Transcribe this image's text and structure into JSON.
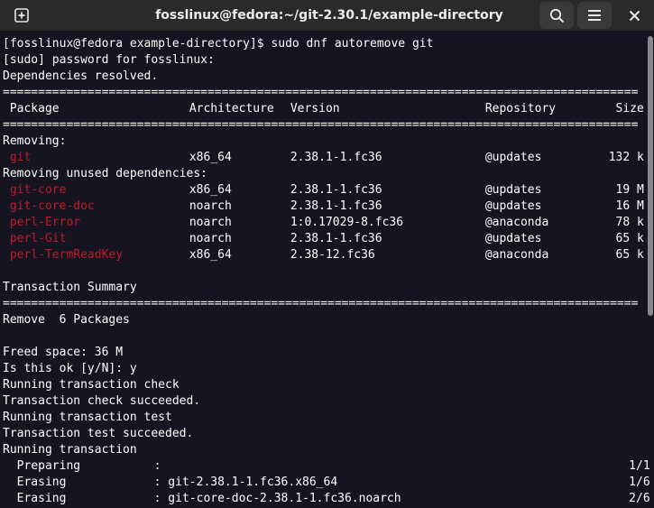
{
  "window": {
    "title": "fosslinux@fedora:~/git-2.30.1/example-directory"
  },
  "icons": {
    "new_tab": "new-tab-icon",
    "search": "search-icon",
    "menu": "hamburger-menu-icon",
    "close": "close-icon"
  },
  "colors": {
    "background": "#171421",
    "package_name": "#c01c28",
    "text": "#ffffff"
  },
  "terminal": {
    "prompt_line": "[fosslinux@fedora example-directory]$ sudo dnf autoremove git",
    "sudo_line": "[sudo] password for fosslinux:",
    "deps_line": "Dependencies resolved.",
    "separator": "==========================================================================================",
    "headers": [
      "Package",
      "Architecture",
      "Version",
      "Repository",
      "Size"
    ],
    "removing_label": "Removing:",
    "removing": [
      {
        "name": "git",
        "arch": "x86_64",
        "version": "2.38.1-1.fc36",
        "repo": "@updates",
        "size": "132 k"
      }
    ],
    "unused_label": "Removing unused dependencies:",
    "unused": [
      {
        "name": "git-core",
        "arch": "x86_64",
        "version": "2.38.1-1.fc36",
        "repo": "@updates",
        "size": "19 M"
      },
      {
        "name": "git-core-doc",
        "arch": "noarch",
        "version": "2.38.1-1.fc36",
        "repo": "@updates",
        "size": "16 M"
      },
      {
        "name": "perl-Error",
        "arch": "noarch",
        "version": "1:0.17029-8.fc36",
        "repo": "@anaconda",
        "size": "78 k"
      },
      {
        "name": "perl-Git",
        "arch": "noarch",
        "version": "2.38.1-1.fc36",
        "repo": "@updates",
        "size": "65 k"
      },
      {
        "name": "perl-TermReadKey",
        "arch": "x86_64",
        "version": "2.38-12.fc36",
        "repo": "@anaconda",
        "size": "65 k"
      }
    ],
    "summary_title": "Transaction Summary",
    "summary_line": "Remove  6 Packages",
    "freed_line": "Freed space: 36 M",
    "confirm_line": "Is this ok [y/N]: y",
    "log_lines": [
      "Running transaction check",
      "Transaction check succeeded.",
      "Running transaction test",
      "Transaction test succeeded.",
      "Running transaction"
    ],
    "progress": [
      {
        "action": "Preparing",
        "target": ":",
        "count": "1/1"
      },
      {
        "action": "Erasing",
        "target": ": git-2.38.1-1.fc36.x86_64",
        "count": "1/6"
      },
      {
        "action": "Erasing",
        "target": ": git-core-doc-2.38.1-1.fc36.noarch",
        "count": "2/6"
      }
    ]
  }
}
